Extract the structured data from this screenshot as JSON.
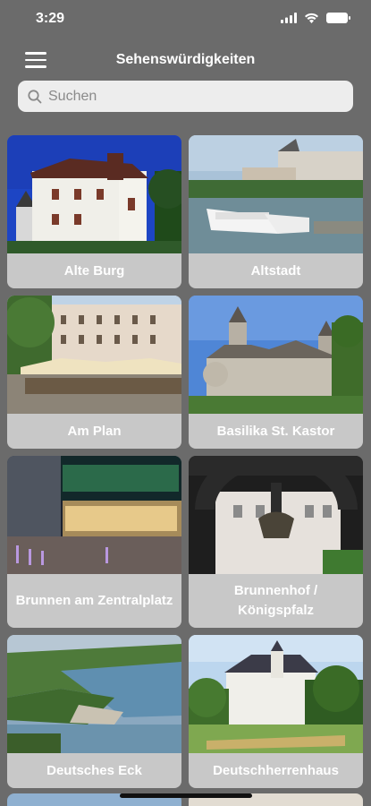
{
  "status": {
    "time": "3:29"
  },
  "nav": {
    "title": "Sehenswürdigkeiten",
    "menu_icon": "hamburger-menu-icon"
  },
  "search": {
    "placeholder": "Suchen",
    "icon": "search-icon"
  },
  "colors": {
    "background": "#6b6b6b",
    "card": "#c8c8c8",
    "search_bg": "#ededed"
  },
  "items": [
    {
      "label": "Alte Burg"
    },
    {
      "label": "Altstadt"
    },
    {
      "label": "Am Plan"
    },
    {
      "label": "Basilika St. Kastor"
    },
    {
      "label": "Brunnen am Zentralplatz"
    },
    {
      "label": "Brunnenhof / Königspfalz"
    },
    {
      "label": "Deutsches Eck"
    },
    {
      "label": "Deutschherrenhaus"
    }
  ]
}
